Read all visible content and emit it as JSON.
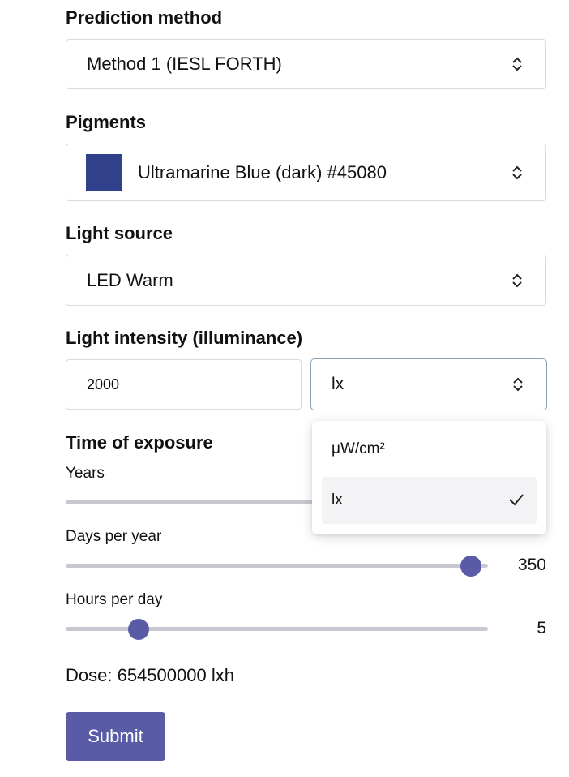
{
  "prediction": {
    "label": "Prediction method",
    "value": "Method 1 (IESL FORTH)"
  },
  "pigments": {
    "label": "Pigments",
    "value": "Ultramarine Blue (dark) #45080",
    "swatch_color": "#31408a"
  },
  "light_source": {
    "label": "Light source",
    "value": "LED Warm"
  },
  "intensity": {
    "label": "Light intensity (illuminance)",
    "value": "2000",
    "unit": "lx"
  },
  "unit_dropdown": {
    "options": [
      {
        "label": "μW/cm²",
        "selected": false
      },
      {
        "label": "lx",
        "selected": true
      }
    ]
  },
  "exposure": {
    "label": "Time of exposure",
    "years": {
      "label": "Years"
    },
    "days": {
      "label": "Days per year",
      "value": "350"
    },
    "hours": {
      "label": "Hours per day",
      "value": "5"
    }
  },
  "dose": "Dose: 654500000 lxh",
  "submit_label": "Submit",
  "colors": {
    "accent": "#5a5ba6",
    "track": "#c8c8d0",
    "border": "#d9d9de"
  }
}
